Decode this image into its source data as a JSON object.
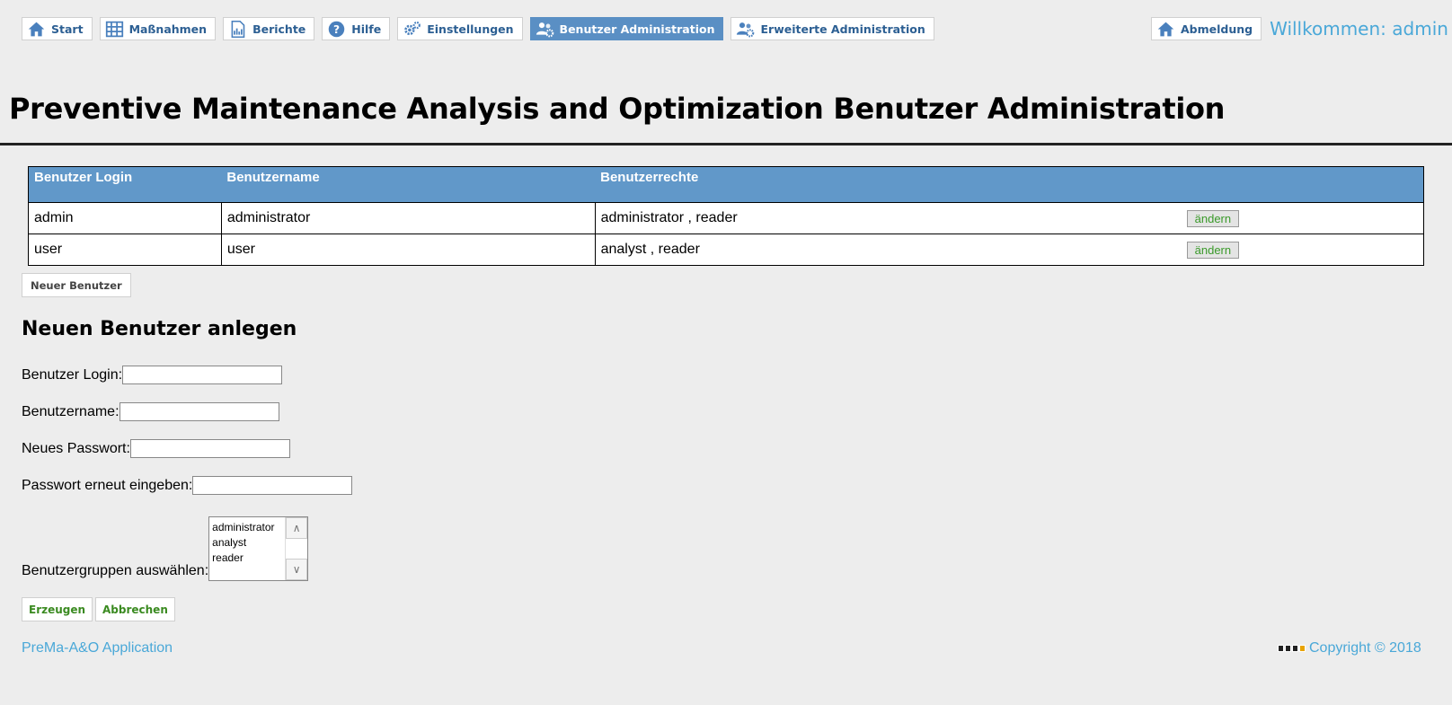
{
  "nav": {
    "items": [
      {
        "label": "Start",
        "icon": "home-icon"
      },
      {
        "label": "Maßnahmen",
        "icon": "table-icon"
      },
      {
        "label": "Berichte",
        "icon": "report-icon"
      },
      {
        "label": "Hilfe",
        "icon": "help-icon"
      },
      {
        "label": "Einstellungen",
        "icon": "gears-icon"
      },
      {
        "label": "Benutzer Administration",
        "icon": "users-icon"
      },
      {
        "label": "Erweiterte Administration",
        "icon": "users-icon"
      }
    ],
    "logout_label": "Abmeldung",
    "welcome": "Willkommen: admin",
    "active_color": "#5a8fc4",
    "text_color": "#2c5f93"
  },
  "page_title": "Preventive Maintenance Analysis and Optimization Benutzer Administration",
  "users_table": {
    "headers": [
      "Benutzer Login",
      "Benutzername",
      "Benutzerrechte",
      ""
    ],
    "rows": [
      {
        "login": "admin",
        "name": "administrator",
        "rights": "administrator , reader",
        "action": "ändern"
      },
      {
        "login": "user",
        "name": "user",
        "rights": "analyst , reader",
        "action": "ändern"
      }
    ],
    "header_color": "#6198c9"
  },
  "new_user_button": "Neuer Benutzer",
  "form": {
    "title": "Neuen Benutzer anlegen",
    "login_label": "Benutzer Login:",
    "login_value": "",
    "name_label": "Benutzername:",
    "name_value": "",
    "password_label": "Neues Passwort:",
    "password_value": "",
    "password_repeat_label": "Passwort erneut eingeben:",
    "password_repeat_value": "",
    "groups_label": "Benutzergruppen auswählen:",
    "groups": [
      "administrator",
      "analyst",
      "reader"
    ],
    "create_label": "Erzeugen",
    "cancel_label": "Abbrechen"
  },
  "footer": {
    "app_name": "PreMa-A&O Application",
    "copyright": "Copyright © 2018",
    "accent_color": "#4aa8d8"
  }
}
